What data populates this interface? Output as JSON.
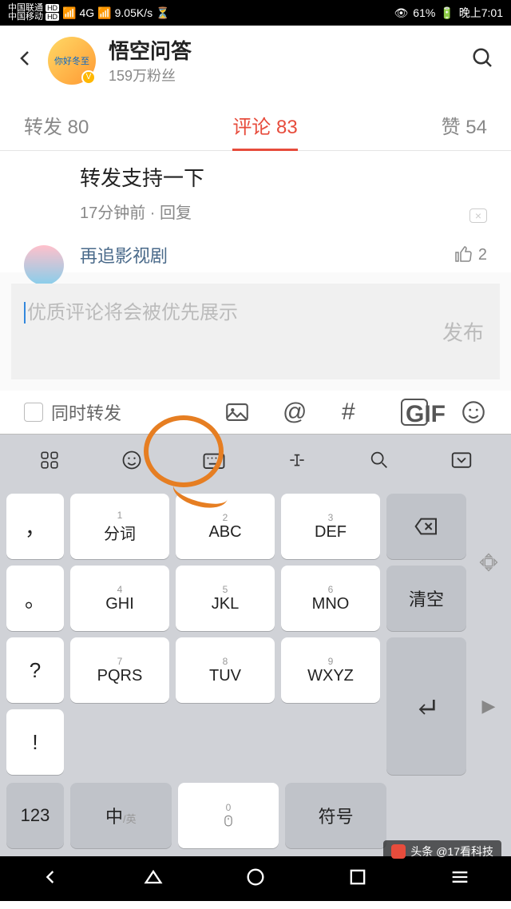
{
  "status_bar": {
    "carrier1": "中国联通",
    "carrier2": "中国移动",
    "hd": "HD",
    "signal": "4G",
    "speed": "9.05K/s",
    "battery_pct": "61%",
    "time": "晚上7:01"
  },
  "header": {
    "name": "悟空问答",
    "fans": "159万粉丝",
    "avatar_text": "你好冬至"
  },
  "tabs": {
    "repost": "转发 80",
    "comment": "评论 83",
    "like": "赞 54"
  },
  "comments": [
    {
      "text": "转发支持一下",
      "meta": "17分钟前 · 回复"
    },
    {
      "user": "再追影视剧",
      "likes": "2"
    }
  ],
  "input": {
    "placeholder": "优质评论将会被优先展示",
    "publish": "发布",
    "forward_label": "同时转发",
    "gif": "GIF",
    "at": "@",
    "hash": "#"
  },
  "keyboard": {
    "rows": [
      {
        "punct": "，",
        "k1_num": "1",
        "k1": "分词",
        "k2_num": "2",
        "k2": "ABC",
        "k3_num": "3",
        "k3": "DEF",
        "side": "⌫"
      },
      {
        "punct": "。",
        "k1_num": "4",
        "k1": "GHI",
        "k2_num": "5",
        "k2": "JKL",
        "k3_num": "6",
        "k3": "MNO",
        "side": "清空"
      },
      {
        "punct": "?",
        "k1_num": "7",
        "k1": "PQRS",
        "k2_num": "8",
        "k2": "TUV",
        "k3_num": "9",
        "k3": "WXYZ",
        "side": "↵"
      },
      {
        "punct": "!"
      }
    ],
    "bottom": {
      "num": "123",
      "lang": "中",
      "lang_sub": "/英",
      "space_num": "0",
      "symbol": "符号"
    }
  },
  "footer": {
    "credit": "头条 @17看科技"
  }
}
